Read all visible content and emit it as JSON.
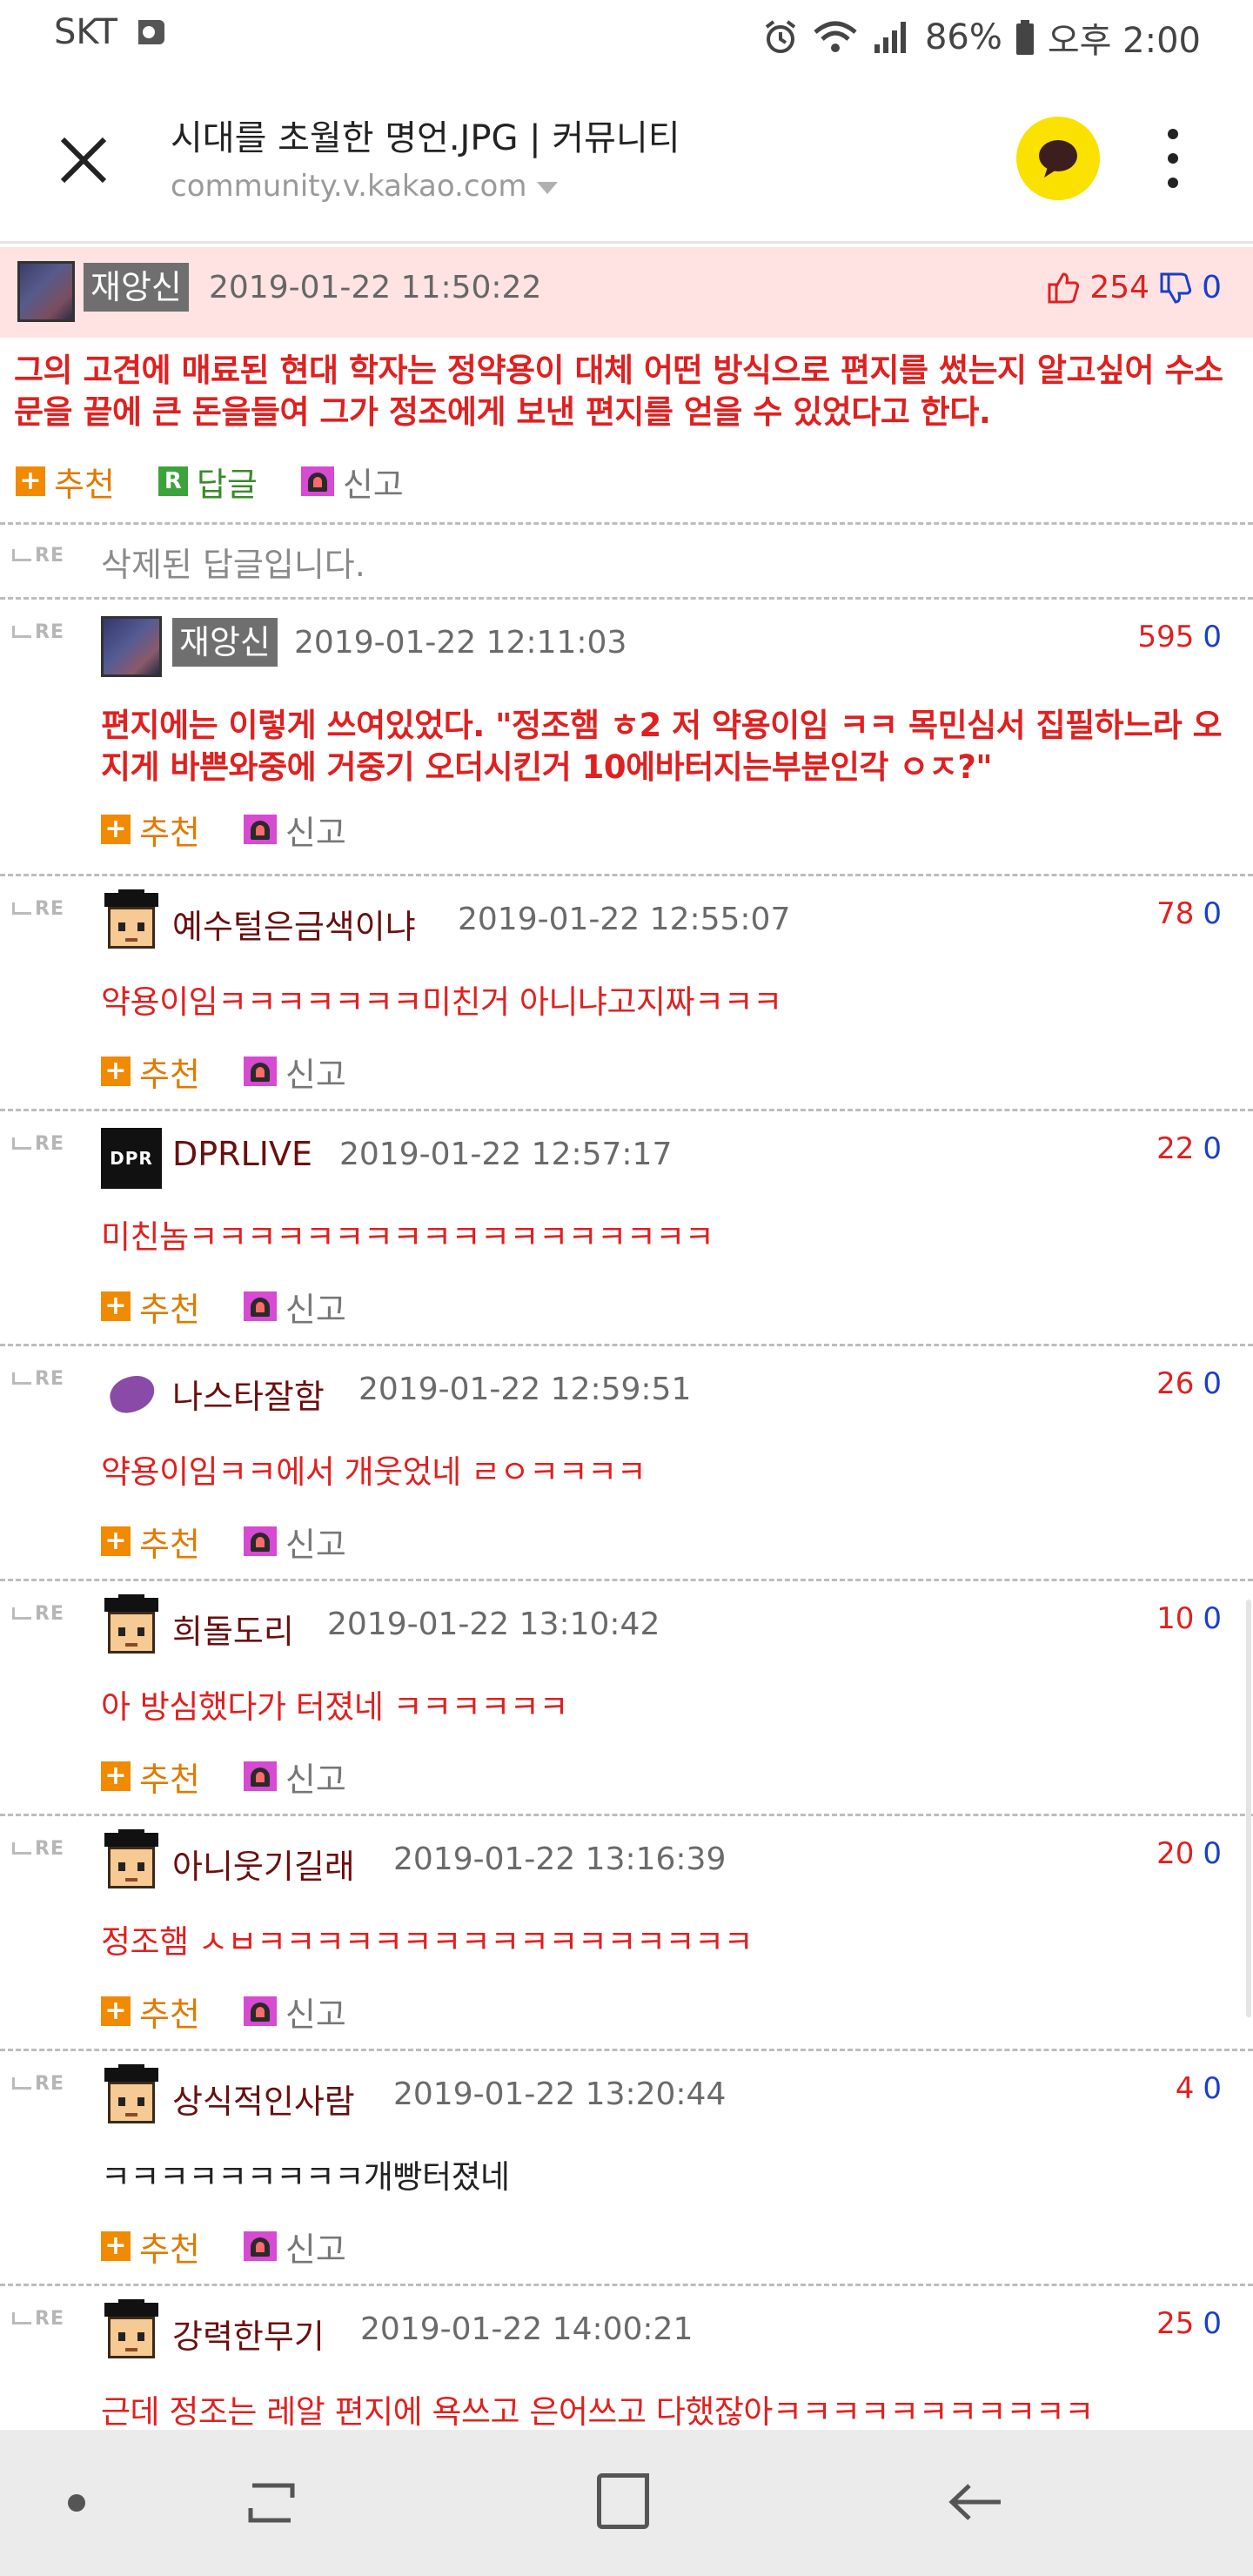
{
  "status_bar": {
    "carrier": "SKT",
    "battery": "86%",
    "time": "오후 2:00"
  },
  "browser": {
    "title": "시대를 초월한 명언.JPG | 커뮤니티",
    "url": "community.v.kakao.com"
  },
  "post": {
    "nickname": "재앙신",
    "date": "2019-01-22 11:50:22",
    "upvotes": "254",
    "downvotes": "0",
    "body": "그의 고견에 매료된 현대 학자는 정약용이 대체 어떤 방식으로 편지를 썼는지 알고싶어 수소문을 끝에 큰 돈을들여 그가 정조에게 보낸 편지를 얻을 수 있었다고 한다.",
    "actions": {
      "recommend": "추천",
      "reply": "답글",
      "report": "신고"
    }
  },
  "re_label": "RE",
  "deleted_reply": "삭제된 답글입니다.",
  "actions": {
    "recommend": "추천",
    "report": "신고"
  },
  "replies": [
    {
      "nickname": "재앙신",
      "date": "2019-01-22 12:11:03",
      "up": "595",
      "down": "0",
      "body": "편지에는 이렇게 쓰여있었다. \"정조햄 ㅎ2 저 약용이임 ㅋㅋ 목민심서 집필하느라 오지게 바쁜와중에 거중기 오더시킨거 10에바터지는부분인각 ㅇㅈ?\""
    },
    {
      "nickname": "예수털은금색이냐",
      "date": "2019-01-22 12:55:07",
      "up": "78",
      "down": "0",
      "body": "약용이임ㅋㅋㅋㅋㅋㅋㅋ미친거 아니냐고지짜ㅋㅋㅋ"
    },
    {
      "nickname": "DPRLIVE",
      "avatar_text": "DPR",
      "date": "2019-01-22 12:57:17",
      "up": "22",
      "down": "0",
      "body": "미친놈ㅋㅋㅋㅋㅋㅋㅋㅋㅋㅋㅋㅋㅋㅋㅋㅋㅋㅋ"
    },
    {
      "nickname": "나스타잘함",
      "date": "2019-01-22 12:59:51",
      "up": "26",
      "down": "0",
      "body": "약용이임ㅋㅋ에서 개웃었네 ㄹㅇㅋㅋㅋㅋ"
    },
    {
      "nickname": "희돌도리",
      "date": "2019-01-22 13:10:42",
      "up": "10",
      "down": "0",
      "body": "아 방심했다가 터졌네 ㅋㅋㅋㅋㅋㅋ"
    },
    {
      "nickname": "아니웃기길래",
      "date": "2019-01-22 13:16:39",
      "up": "20",
      "down": "0",
      "body": "정조햄 ㅅㅂㅋㅋㅋㅋㅋㅋㅋㅋㅋㅋㅋㅋㅋㅋㅋㅋㅋ"
    },
    {
      "nickname": "상식적인사람",
      "date": "2019-01-22 13:20:44",
      "up": "4",
      "down": "0",
      "body": "ㅋㅋㅋㅋㅋㅋㅋㅋㅋ개빵터졌네"
    },
    {
      "nickname": "강력한무기",
      "date": "2019-01-22 14:00:21",
      "up": "25",
      "down": "0",
      "body": "근데 정조는 레알 편지에 욕쓰고 은어쓰고 다했잖아ㅋㅋㅋㅋㅋㅋㅋㅋㅋㅋㅋ"
    }
  ],
  "colors": {
    "highlight_bg": "#ffe3e3",
    "text_red": "#e02020",
    "down_blue": "#1a3fc8",
    "kakao_yellow": "#fae100",
    "recommend_orange": "#f08a00"
  }
}
